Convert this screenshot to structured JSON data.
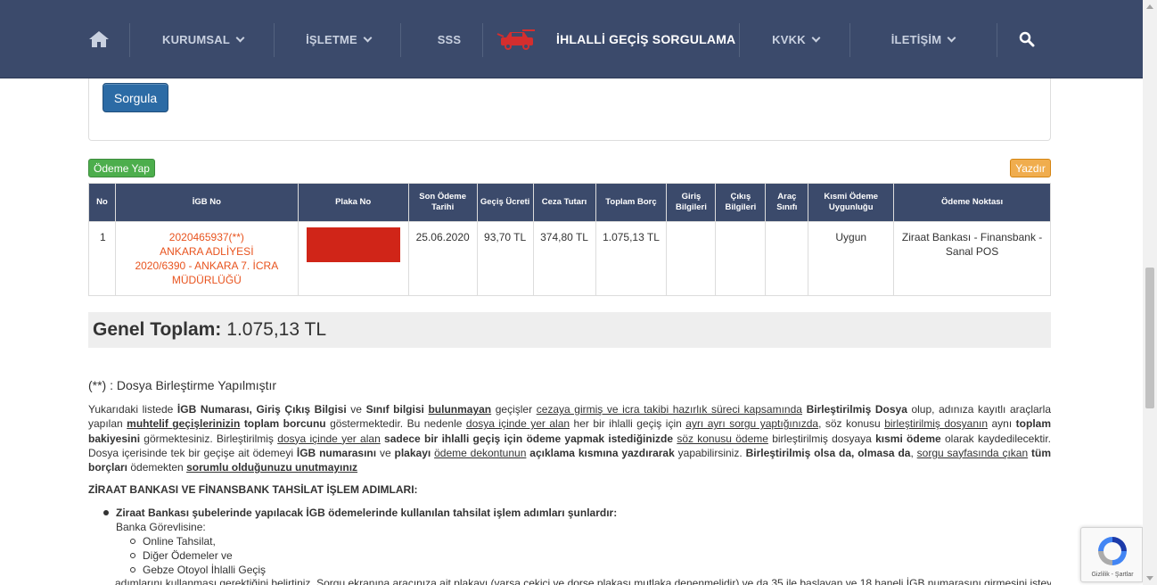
{
  "nav": {
    "items": [
      {
        "label": "KURUMSAL"
      },
      {
        "label": "İŞLETME"
      },
      {
        "label": "SSS"
      },
      {
        "label": "İHLALLİ GEÇİŞ SORGULAMA"
      },
      {
        "label": "KVKK"
      },
      {
        "label": "İLETİŞİM"
      }
    ]
  },
  "form": {
    "submit_label": "Sorgula"
  },
  "actions": {
    "pay_label": "Ödeme Yap",
    "print_label": "Yazdır"
  },
  "table": {
    "headers": [
      "No",
      "İGB No",
      "Plaka No",
      "Son Ödeme Tarihi",
      "Geçiş Ücreti",
      "Ceza Tutarı",
      "Toplam Borç",
      "Giriş Bilgileri",
      "Çıkış Bilgileri",
      "Araç Sınıfı",
      "Kısmi Ödeme Uygunluğu",
      "Ödeme Noktası"
    ],
    "rows": [
      {
        "no": "1",
        "igb_lines": [
          "2020465937(**)",
          "ANKARA ADLİYESİ",
          "2020/6390 - ANKARA 7. İCRA",
          "MÜDÜRLÜĞÜ"
        ],
        "son_odeme": "25.06.2020",
        "gecis_ucreti": "93,70 TL",
        "ceza_tutari": "374,80 TL",
        "toplam_borc": "1.075,13 TL",
        "giris": "",
        "cikis": "",
        "arac_sinifi": "",
        "kismi_odeme": "Uygun",
        "odeme_noktasi": "Ziraat Bankası - Finansbank - Sanal POS"
      }
    ]
  },
  "total": {
    "label": "Genel Toplam:",
    "value": "1.075,13 TL"
  },
  "note": "(**) : Dosya Birleştirme Yapılmıştır",
  "info": {
    "p1_a": "Yukarıdaki listede ",
    "p1_b": "İGB Numarası, Giriş Çıkış Bilgisi",
    "p1_c": " ve ",
    "p1_d": "Sınıf bilgisi",
    "p1_e": " ",
    "p1_f": "bulunmayan",
    "p1_g": " geçişler ",
    "p1_h": "cezaya girmiş ve icra takibi hazırlık süreci kapsamında",
    "p1_i": " ",
    "p1_j": "Birleştirilmiş Dosya",
    "p1_k": " olup, adınıza kayıtlı araçlarla yapılan ",
    "p1_l": "muhtelif geçişlerinizin",
    "p1_m": " ",
    "p1_n": "toplam borcunu",
    "p1_o": " göstermektedir. Bu nedenle ",
    "p1_p": "dosya içinde yer alan",
    "p1_q": " her bir ihlalli geçiş için ",
    "p1_r": "ayrı ayrı sorgu yaptığınızda",
    "p1_s": ", söz konusu ",
    "p1_t": "birleştirilmiş dosyanın",
    "p1_u": " aynı ",
    "p1_v": "toplam bakiyesini",
    "p1_w": " görmektesiniz. Birleştirilmiş ",
    "p1_x": "dosya içinde yer alan",
    "p1_y": " ",
    "p1_z": "sadece bir ihlalli geçiş için ödeme yapmak istediğinizde",
    "p2_a": " ",
    "p2_b": "söz konusu ödeme",
    "p2_c": " birleştirilmiş dosyaya ",
    "p2_d": "kısmi ödeme",
    "p2_e": " olarak kaydedilecektir. Dosya içerisinde tek bir geçişe ait ödemeyi ",
    "p2_f": "İGB numarasını",
    "p2_g": " ve ",
    "p2_h": "plakayı",
    "p2_i": " ",
    "p2_j": "ödeme dekontunun",
    "p2_k": " ",
    "p2_l": "açıklama kısmına yazdırarak",
    "p2_m": " yapabilirsiniz. ",
    "p2_n": "Birleştirilmiş olsa da, olmasa da",
    "p2_o": ", ",
    "p2_p": "sorgu sayfasında çıkan",
    "p2_q": " ",
    "p2_r": "tüm borçları",
    "p2_s": " ödemekten ",
    "p2_t": "sorumlu olduğunuzu unutmayınız"
  },
  "section_heading": "ZİRAAT BANKASI VE FİNANSBANK TAHSİLAT İŞLEM ADIMLARI:",
  "steps": {
    "title": "Ziraat Bankası şubelerinde yapılacak İGB ödemelerinde kullanılan tahsilat işlem adımları şunlardır:",
    "intro": "Banka Görevlisine:",
    "items": [
      "Online Tahsilat,",
      "Diğer Ödemeler ve",
      "Gebze Otoyol İhlalli Geçiş"
    ],
    "cut_text": "adımlarını kullanması gerektiğini belirtiniz. Sorgu ekranına aracınıza ait plakayı (varsa çekici ve dorse plakası mutlaka denenmelidir) ve da 35 ile başlayan ve 18 haneli İGB numarasını girmesini isteyiniz"
  },
  "recaptcha": {
    "footer": "Gizlilik - Şartlar"
  },
  "colors": {
    "nav": "#3b4a6b",
    "pay": "#4cae4c",
    "print": "#f0ad4e",
    "igb_text": "#e8531e",
    "plate_mask": "#d02518"
  },
  "icons": [
    "home-icon",
    "car-icon",
    "search-icon",
    "chevron-down-icon",
    "recaptcha-icon"
  ]
}
